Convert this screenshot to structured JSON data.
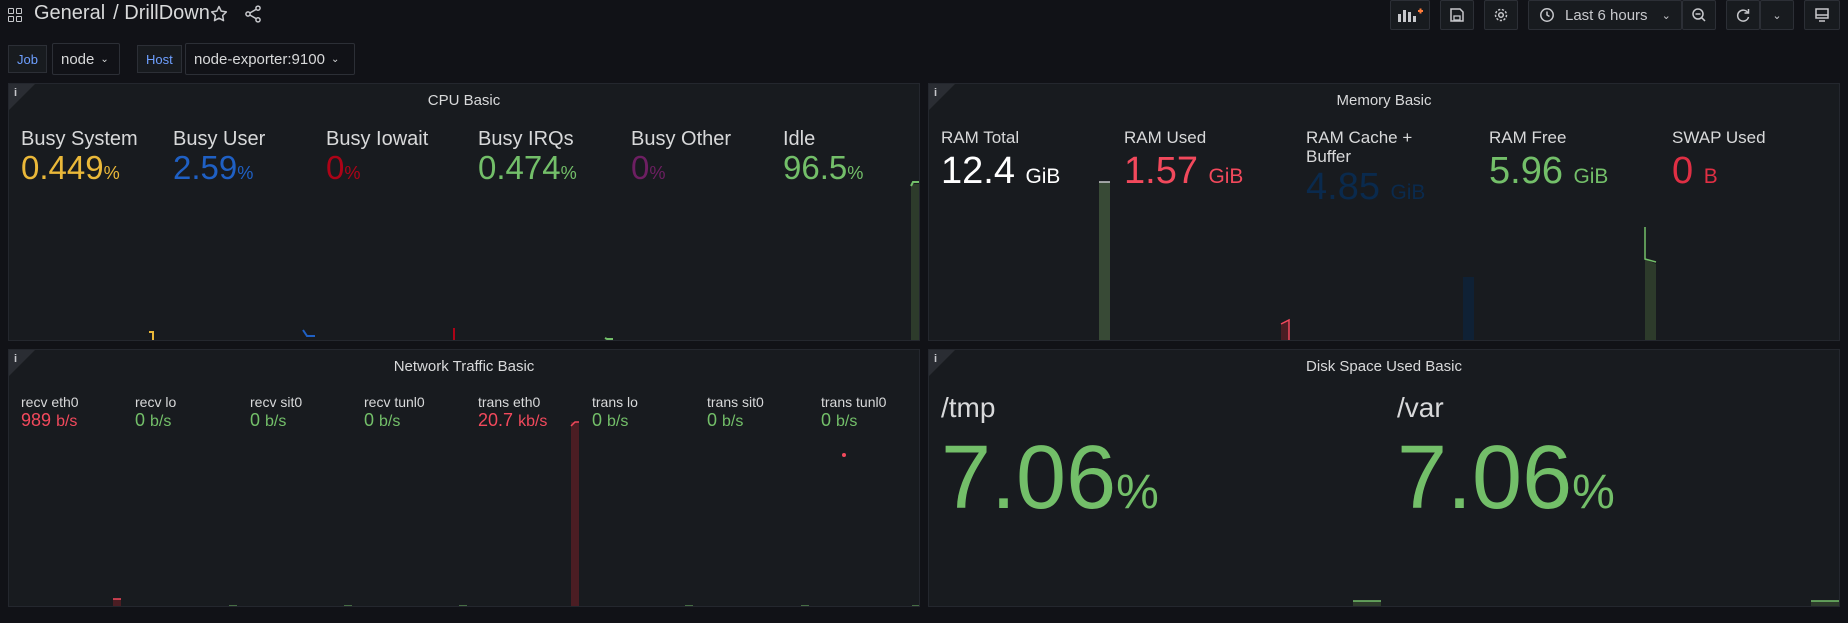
{
  "nav": {
    "folder": "General",
    "dashboard": "/ DrillDown",
    "time_range": "Last 6 hours"
  },
  "variables": [
    {
      "label": "Job",
      "value": "node"
    },
    {
      "label": "Host",
      "value": "node-exporter:9100"
    }
  ],
  "panels": {
    "cpu": {
      "title": "CPU Basic",
      "stats": [
        {
          "label": "Busy System",
          "value": "0.449",
          "unit": "%",
          "color": "#eab839"
        },
        {
          "label": "Busy User",
          "value": "2.59",
          "unit": "%",
          "color": "#1f60c4"
        },
        {
          "label": "Busy Iowait",
          "value": "0",
          "unit": "%",
          "color": "#ad0317"
        },
        {
          "label": "Busy IRQs",
          "value": "0.474",
          "unit": "%",
          "color": "#73bf69"
        },
        {
          "label": "Busy Other",
          "value": "0",
          "unit": "%",
          "color": "#6d1f62"
        },
        {
          "label": "Idle",
          "value": "96.5",
          "unit": "%",
          "color": "#73bf69"
        }
      ]
    },
    "memory": {
      "title": "Memory Basic",
      "stats": [
        {
          "label": "RAM Total",
          "value": "12.4",
          "unit": "GiB",
          "color": "#ffffff"
        },
        {
          "label": "RAM Used",
          "value": "1.57",
          "unit": "GiB",
          "color": "#f2495c"
        },
        {
          "label": "RAM Cache + Buffer",
          "value": "4.85",
          "unit": "GiB",
          "color": "#0a2a4d"
        },
        {
          "label": "RAM Free",
          "value": "5.96",
          "unit": "GiB",
          "color": "#73bf69"
        },
        {
          "label": "SWAP Used",
          "value": "0",
          "unit": "B",
          "color": "#e02f44"
        }
      ]
    },
    "network": {
      "title": "Network Traffic Basic",
      "stats": [
        {
          "label": "recv eth0",
          "value": "989",
          "unit": "b/s",
          "color": "#f2495c"
        },
        {
          "label": "recv lo",
          "value": "0",
          "unit": "b/s",
          "color": "#73bf69"
        },
        {
          "label": "recv sit0",
          "value": "0",
          "unit": "b/s",
          "color": "#73bf69"
        },
        {
          "label": "recv tunl0",
          "value": "0",
          "unit": "b/s",
          "color": "#73bf69"
        },
        {
          "label": "trans eth0",
          "value": "20.7",
          "unit": "kb/s",
          "color": "#f2495c"
        },
        {
          "label": "trans lo",
          "value": "0",
          "unit": "b/s",
          "color": "#73bf69"
        },
        {
          "label": "trans sit0",
          "value": "0",
          "unit": "b/s",
          "color": "#73bf69"
        },
        {
          "label": "trans tunl0",
          "value": "0",
          "unit": "b/s",
          "color": "#73bf69"
        }
      ]
    },
    "disk": {
      "title": "Disk Space Used Basic",
      "stats": [
        {
          "label": "/tmp",
          "value": "7.06",
          "unit": "%",
          "color": "#73bf69"
        },
        {
          "label": "/var",
          "value": "7.06",
          "unit": "%",
          "color": "#73bf69"
        }
      ]
    }
  }
}
